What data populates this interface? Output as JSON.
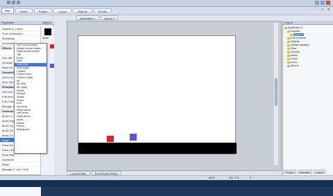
{
  "app": {
    "menu_button": "Main",
    "ribbon_tabs": [
      "Home",
      "Project",
      "Layout",
      "Objects",
      "Events"
    ],
    "window_controls": [
      "–",
      "□",
      "✕"
    ]
  },
  "doc_tabs": [
    "Application 1",
    "Layout 1"
  ],
  "left_panel": {
    "properties_header": "Properties",
    "objects_header": "Objects",
    "object_label": "Sprite",
    "rows": [
      {
        "name": "Sampling",
        "value": "Linear",
        "group": false
      },
      {
        "name": "Font",
        "value": "Antialiased",
        "group": false
      },
      {
        "name": "Multisamp",
        "value": "",
        "group": false
      },
      {
        "name": "UI behavio",
        "value": "",
        "group": false
      },
      {
        "name": "Effects",
        "value": "",
        "group": true
      },
      {
        "name": "",
        "value": "",
        "group": false
      },
      {
        "name": "Run with",
        "value": "",
        "group": false
      },
      {
        "name": "Simulate",
        "value": "",
        "group": false
      },
      {
        "name": "Motion B",
        "value": "",
        "group": false
      },
      {
        "name": "Sounds/Dis",
        "value": "",
        "group": true
      },
      {
        "name": "Add Icon",
        "value": "",
        "group": false
      },
      {
        "name": "Auto Sav",
        "value": "",
        "group": false
      },
      {
        "name": "Grouping",
        "value": "",
        "group": true
      },
      {
        "name": "Add Item",
        "value": "",
        "group": false
      },
      {
        "name": "Edit Item",
        "value": "",
        "group": false
      },
      {
        "name": "Edit Forms",
        "value": "",
        "group": false
      },
      {
        "name": "Manage F",
        "value": "",
        "group": false
      },
      {
        "name": "Controls",
        "value": "",
        "group": true
      },
      {
        "name": "Move Le",
        "value": "",
        "group": false
      },
      {
        "name": "Move Rig",
        "value": "",
        "group": false
      },
      {
        "name": "Move Up",
        "value": "",
        "group": false
      },
      {
        "name": "Move Dn",
        "value": "",
        "group": false
      },
      {
        "name": "Move Do",
        "value": "",
        "group": false
      },
      {
        "name": "Jump",
        "value": "",
        "group": false,
        "sel": true
      },
      {
        "name": "Draw left",
        "value": "",
        "group": false
      },
      {
        "name": "Draw Left",
        "value": "",
        "group": false
      },
      {
        "name": "Draw Rigt",
        "value": "",
        "group": false
      },
      {
        "name": "Accelerat",
        "value": "",
        "group": false
      },
      {
        "name": "Brake",
        "value": "",
        "group": false
      },
      {
        "name": "Manage C",
        "value": "Add / Edit",
        "group": false
      }
    ],
    "description_title": "Jump (F1)",
    "description_sub": "A control key..."
  },
  "dropdown": {
    "items": [
      "Left mouse button",
      "Middle mouse button",
      "Right mouse button",
      "Tab",
      "Enter",
      "Shift",
      "Shift (left)",
      "Shift (right)",
      "Control",
      "Control (left)",
      "Control (right)",
      "Alt",
      "Alt (left)",
      "Alt (right)",
      "Pause",
      "Escape",
      "Space",
      "Home",
      "End",
      "Up arrow",
      "Down arrow",
      "Left arrow",
      "Right arrow",
      "Insert",
      "Delete",
      "Return",
      "Backspace"
    ],
    "selected_index": 6
  },
  "layout": {
    "bottom_tabs": [
      "Layout Editor",
      "Event Sheet Editor"
    ]
  },
  "project_panel": {
    "header": "Project",
    "items": [
      {
        "label": "Application 1",
        "indent": 0,
        "sel": false
      },
      {
        "label": "Layouts",
        "indent": 1,
        "sel": false
      },
      {
        "label": "Layout 1",
        "indent": 2,
        "sel": true
      },
      {
        "label": "Event sheets",
        "indent": 1,
        "sel": false
      },
      {
        "label": "Objects",
        "indent": 1,
        "sel": false
      },
      {
        "label": "Global variables",
        "indent": 1,
        "sel": false
      },
      {
        "label": "Files",
        "indent": 1,
        "sel": false
      },
      {
        "label": "Sounds",
        "indent": 1,
        "sel": false
      },
      {
        "label": "Music",
        "indent": 1,
        "sel": false
      },
      {
        "label": "Fonts",
        "indent": 1,
        "sel": false
      },
      {
        "label": "Icons",
        "indent": 1,
        "sel": false
      },
      {
        "label": "Menus",
        "indent": 1,
        "sel": false
      }
    ],
    "tabs": [
      "Project",
      "Animator",
      "Layers"
    ]
  },
  "status": {
    "zoom": "100%",
    "coords": "252, 171",
    "extra": "0"
  },
  "colors": {
    "red_object": "#e02020",
    "blue_object": "#5a55e0",
    "selection": "#3c78d8"
  }
}
